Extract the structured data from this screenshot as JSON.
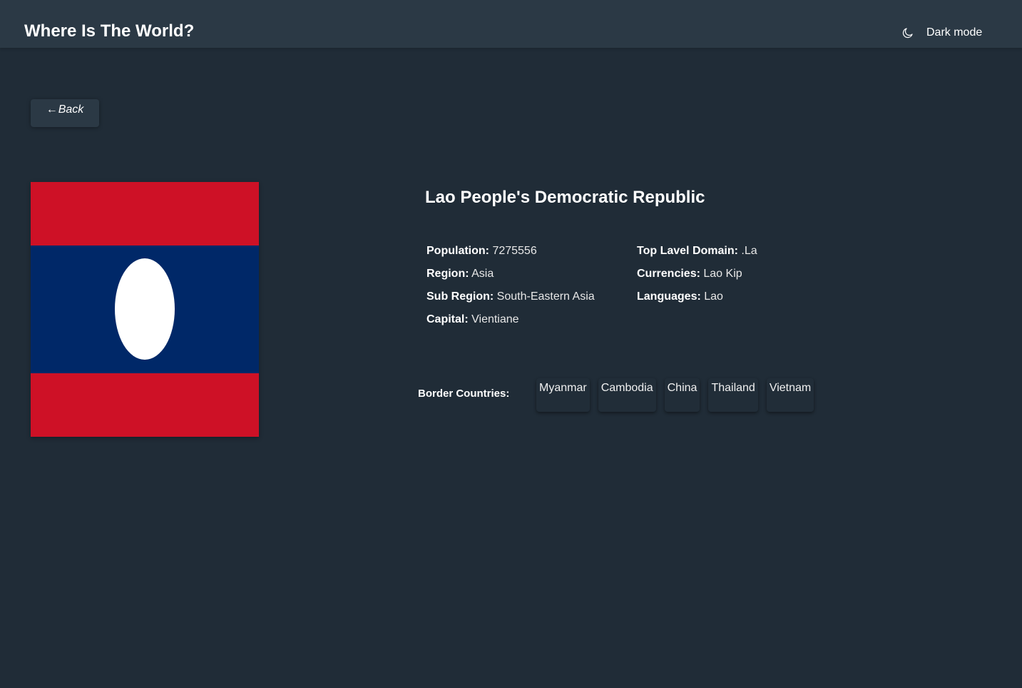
{
  "header": {
    "title": "Where Is The World?",
    "theme_icon": "moon-icon",
    "theme_label": "Dark mode"
  },
  "back_button": {
    "arrow": "←",
    "label": "Back"
  },
  "flag": {
    "colors": {
      "red": "#ce1126",
      "blue": "#002868",
      "disc": "#ffffff"
    }
  },
  "country": {
    "name": "Lao People's Democratic Republic",
    "population": {
      "label": "Population:",
      "value": "7275556"
    },
    "region": {
      "label": "Region:",
      "value": "Asia"
    },
    "sub_region": {
      "label": "Sub Region:",
      "value": "South-Eastern Asia"
    },
    "capital": {
      "label": "Capital:",
      "value": "Vientiane"
    },
    "top_level_domain": {
      "label": "Top Lavel Domain:",
      "value": ".La"
    },
    "currencies": {
      "label": "Currencies:",
      "value": "Lao Kip"
    },
    "languages": {
      "label": "Languages:",
      "value": "Lao"
    }
  },
  "border_countries": {
    "label": "Border Countries:",
    "items": [
      "Myanmar",
      "Cambodia",
      "China",
      "Thailand",
      "Vietnam"
    ]
  },
  "colors": {
    "background": "#202c37",
    "elements": "#2b3945",
    "text": "#ffffff"
  }
}
